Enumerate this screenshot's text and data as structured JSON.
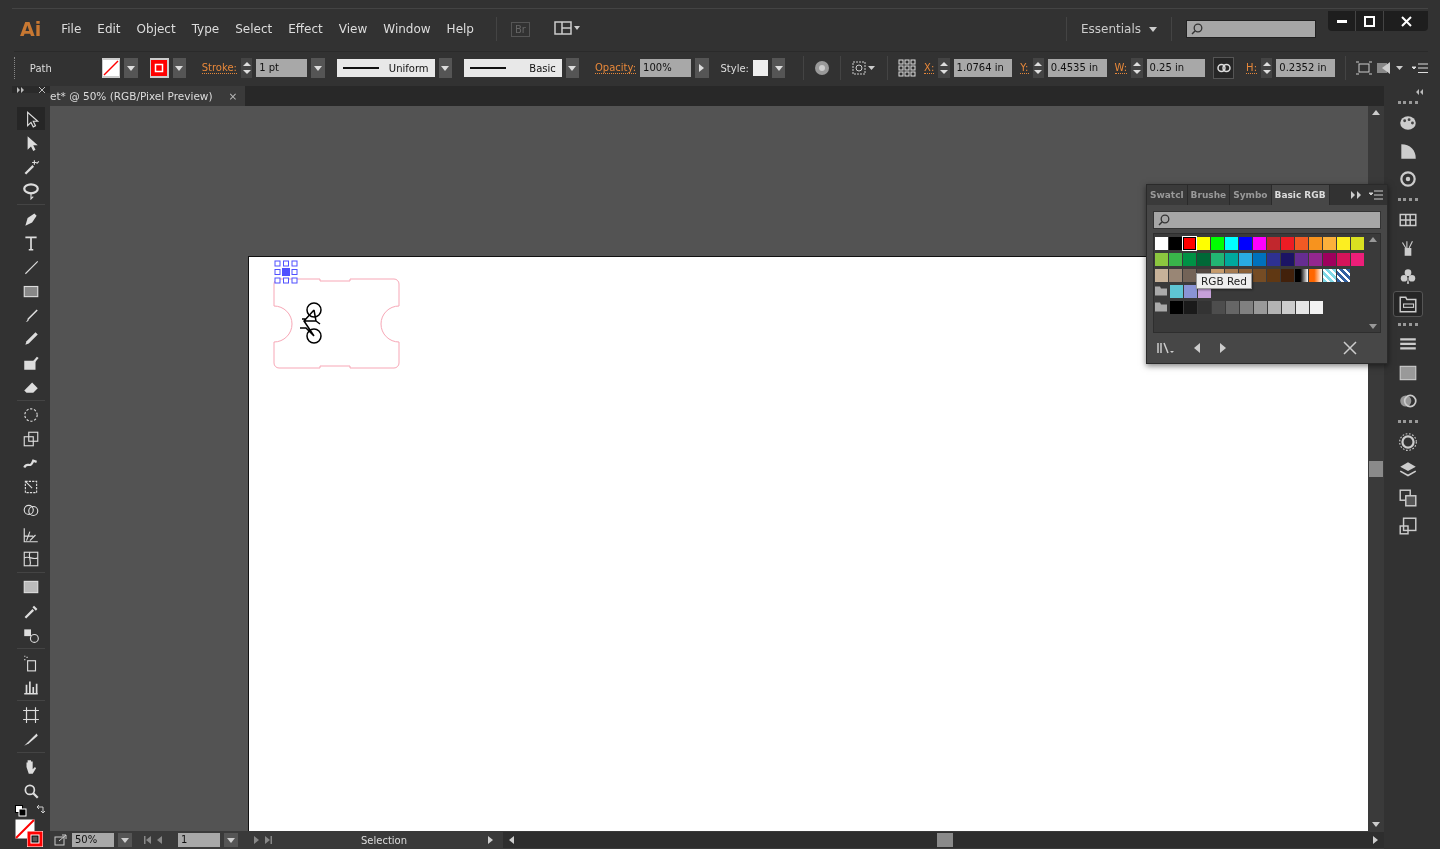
{
  "app": {
    "logo": "Ai",
    "menu": [
      "File",
      "Edit",
      "Object",
      "Type",
      "Select",
      "Effect",
      "View",
      "Window",
      "Help"
    ],
    "bridge": "Br",
    "workspace": "Essentials"
  },
  "control_bar": {
    "selection": "Path",
    "stroke_label": "Stroke:",
    "stroke_weight": "1 pt",
    "profile": "Uniform",
    "brush": "Basic",
    "opacity_label": "Opacity:",
    "opacity": "100%",
    "style_label": "Style:",
    "transform": [
      {
        "label": "X:",
        "value": "1.0764 in"
      },
      {
        "label": "Y:",
        "value": "0.4535 in"
      },
      {
        "label": "W:",
        "value": "0.25 in"
      },
      {
        "label": "H:",
        "value": "0.2352 in"
      }
    ],
    "constrain_proportions": true
  },
  "document_tab": {
    "title": "et* @ 50% (RGB/Pixel Preview)",
    "close": "×"
  },
  "tools": [
    {
      "kind": "selection",
      "selected": true
    },
    {
      "kind": "direct-selection",
      "selected": false
    },
    {
      "kind": "magic-wand",
      "selected": false
    },
    {
      "kind": "lasso",
      "selected": false
    },
    {
      "kind": "pen",
      "selected": false
    },
    {
      "kind": "type",
      "selected": false
    },
    {
      "kind": "line",
      "selected": false
    },
    {
      "kind": "rectangle",
      "selected": false
    },
    {
      "kind": "paintbrush",
      "selected": false
    },
    {
      "kind": "pencil",
      "selected": false
    },
    {
      "kind": "blob-brush",
      "selected": false
    },
    {
      "kind": "eraser",
      "selected": false
    },
    {
      "kind": "rotate",
      "selected": false
    },
    {
      "kind": "scale",
      "selected": false
    },
    {
      "kind": "warp",
      "selected": false
    },
    {
      "kind": "free-transform",
      "selected": false
    },
    {
      "kind": "shape-builder",
      "selected": false
    },
    {
      "kind": "perspective",
      "selected": false
    },
    {
      "kind": "mesh",
      "selected": false
    },
    {
      "kind": "gradient",
      "selected": false
    },
    {
      "kind": "eyedropper",
      "selected": false
    },
    {
      "kind": "blend",
      "selected": false
    },
    {
      "kind": "symbol-sprayer",
      "selected": false
    },
    {
      "kind": "column-graph",
      "selected": false
    },
    {
      "kind": "artboard",
      "selected": false
    },
    {
      "kind": "slice",
      "selected": false
    },
    {
      "kind": "hand",
      "selected": false
    },
    {
      "kind": "zoom",
      "selected": false
    }
  ],
  "swatches_panel": {
    "tabs": [
      {
        "label": "Swatcl",
        "selected": false
      },
      {
        "label": "Brushe",
        "selected": false
      },
      {
        "label": "Symbo",
        "selected": false
      },
      {
        "label": "Basic RGB",
        "selected": true
      }
    ],
    "rows": [
      {
        "folder": false,
        "swatches": [
          {
            "kind": "solid",
            "color": "#ffffff",
            "selected": false
          },
          {
            "kind": "solid",
            "color": "#000000",
            "selected": false
          },
          {
            "kind": "solid",
            "color": "#ff0000",
            "selected": true
          },
          {
            "kind": "solid",
            "color": "#ffff00",
            "selected": false
          },
          {
            "kind": "solid",
            "color": "#00ff00",
            "selected": false
          },
          {
            "kind": "solid",
            "color": "#00ffff",
            "selected": false
          },
          {
            "kind": "solid",
            "color": "#0000ff",
            "selected": false
          },
          {
            "kind": "solid",
            "color": "#ff00ff",
            "selected": false
          },
          {
            "kind": "solid",
            "color": "#c1272d",
            "selected": false
          },
          {
            "kind": "solid",
            "color": "#ed1c24",
            "selected": false
          },
          {
            "kind": "solid",
            "color": "#f15a24",
            "selected": false
          },
          {
            "kind": "solid",
            "color": "#f7931e",
            "selected": false
          },
          {
            "kind": "solid",
            "color": "#fbb03b",
            "selected": false
          },
          {
            "kind": "solid",
            "color": "#fcee21",
            "selected": false
          },
          {
            "kind": "solid",
            "color": "#d9e021",
            "selected": false
          }
        ]
      },
      {
        "folder": false,
        "swatches": [
          {
            "kind": "solid",
            "color": "#8cc63f",
            "selected": false
          },
          {
            "kind": "solid",
            "color": "#39b54a",
            "selected": false
          },
          {
            "kind": "solid",
            "color": "#009245",
            "selected": false
          },
          {
            "kind": "solid",
            "color": "#006837",
            "selected": false
          },
          {
            "kind": "solid",
            "color": "#22b573",
            "selected": false
          },
          {
            "kind": "solid",
            "color": "#00a99d",
            "selected": false
          },
          {
            "kind": "solid",
            "color": "#29abe2",
            "selected": false
          },
          {
            "kind": "solid",
            "color": "#0071bc",
            "selected": false
          },
          {
            "kind": "solid",
            "color": "#2e3192",
            "selected": false
          },
          {
            "kind": "solid",
            "color": "#1b1464",
            "selected": false
          },
          {
            "kind": "solid",
            "color": "#662d91",
            "selected": false
          },
          {
            "kind": "solid",
            "color": "#93278f",
            "selected": false
          },
          {
            "kind": "solid",
            "color": "#9e005d",
            "selected": false
          },
          {
            "kind": "solid",
            "color": "#d4145a",
            "selected": false
          },
          {
            "kind": "solid",
            "color": "#ed1e79",
            "selected": false
          }
        ]
      },
      {
        "folder": false,
        "swatches": [
          {
            "kind": "solid",
            "color": "#c7b299",
            "selected": false
          },
          {
            "kind": "solid",
            "color": "#998675",
            "selected": false
          },
          {
            "kind": "solid",
            "color": "#736357",
            "selected": false
          },
          {
            "kind": "solid",
            "color": "#534741",
            "selected": false
          },
          {
            "kind": "solid",
            "color": "#c69c6d",
            "selected": false
          },
          {
            "kind": "solid",
            "color": "#a67c52",
            "selected": false
          },
          {
            "kind": "solid",
            "color": "#8c6239",
            "selected": false
          },
          {
            "kind": "solid",
            "color": "#754c24",
            "selected": false
          },
          {
            "kind": "solid",
            "color": "#603813",
            "selected": false
          },
          {
            "kind": "solid",
            "color": "#42210b",
            "selected": false
          },
          {
            "kind": "gradient",
            "color": "#000000",
            "selected": false
          },
          {
            "kind": "gradient",
            "color": "#ff6600",
            "selected": false
          },
          {
            "kind": "pattern",
            "color": "#7fd8e6",
            "selected": false
          },
          {
            "kind": "pattern",
            "color": "#3060a0",
            "selected": false
          }
        ]
      },
      {
        "folder": true,
        "swatches": [
          {
            "kind": "solid",
            "color": "#5ec5d3",
            "selected": false
          },
          {
            "kind": "solid",
            "color": "#8a94d5",
            "selected": false
          },
          {
            "kind": "solid",
            "color": "#c6a0d9",
            "selected": false
          }
        ]
      },
      {
        "folder": true,
        "swatches": [
          {
            "kind": "solid",
            "color": "#000000",
            "selected": false
          },
          {
            "kind": "solid",
            "color": "#1a1a1a",
            "selected": false
          },
          {
            "kind": "solid",
            "color": "#333333",
            "selected": false
          },
          {
            "kind": "solid",
            "color": "#4d4d4d",
            "selected": false
          },
          {
            "kind": "solid",
            "color": "#666666",
            "selected": false
          },
          {
            "kind": "solid",
            "color": "#808080",
            "selected": false
          },
          {
            "kind": "solid",
            "color": "#999999",
            "selected": false
          },
          {
            "kind": "solid",
            "color": "#b3b3b3",
            "selected": false
          },
          {
            "kind": "solid",
            "color": "#cccccc",
            "selected": false
          },
          {
            "kind": "solid",
            "color": "#e6e6e6",
            "selected": false
          },
          {
            "kind": "solid",
            "color": "#f2f2f2",
            "selected": false
          }
        ]
      }
    ],
    "tooltip": "RGB Red"
  },
  "dock": [
    {
      "kind": "color-guide",
      "selected": false
    },
    {
      "kind": "color",
      "selected": false
    },
    {
      "kind": "recolor",
      "selected": false
    },
    {
      "kind": "swatches",
      "selected": false
    },
    {
      "kind": "brushes",
      "selected": false
    },
    {
      "kind": "symbols",
      "selected": false
    },
    {
      "kind": "swatch-library",
      "selected": true
    },
    {
      "kind": "stroke",
      "selected": false
    },
    {
      "kind": "gradient",
      "selected": false
    },
    {
      "kind": "transparency",
      "selected": false
    },
    {
      "kind": "appearance",
      "selected": false
    },
    {
      "kind": "layers",
      "selected": false
    },
    {
      "kind": "artboards",
      "selected": false
    },
    {
      "kind": "export",
      "selected": false
    }
  ],
  "status_bar": {
    "zoom": "50%",
    "artboard": "1",
    "status": "Selection"
  }
}
